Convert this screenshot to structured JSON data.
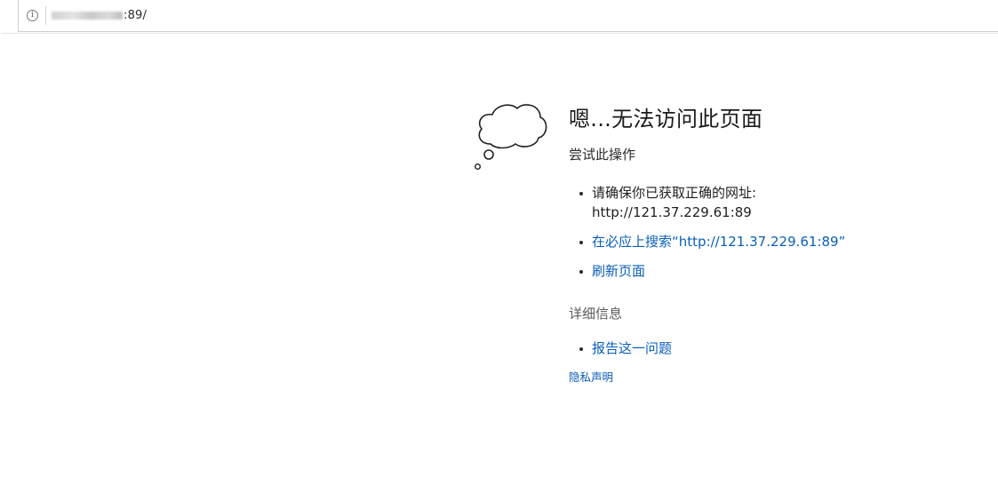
{
  "address_bar": {
    "url_visible_suffix": ":89/"
  },
  "icons": {
    "info": "info-circle-icon",
    "illustration": "thought-cloud-icon"
  },
  "error": {
    "heading": "嗯...无法访问此页面",
    "subheading": "尝试此操作",
    "suggestions": [
      {
        "text": "请确保你已获取正确的网址:",
        "text2": "http://121.37.229.61:89"
      },
      {
        "text": "在必应上搜索“http://121.37.229.61:89”"
      },
      {
        "text": "刷新页面"
      }
    ],
    "details_title": "详细信息",
    "details_items": [
      {
        "text": "报告这一问题"
      }
    ],
    "privacy_link": "隐私声明"
  },
  "colors": {
    "link": "#0a5fb8",
    "text": "#1f1f1f",
    "muted": "#5a5a5a"
  }
}
